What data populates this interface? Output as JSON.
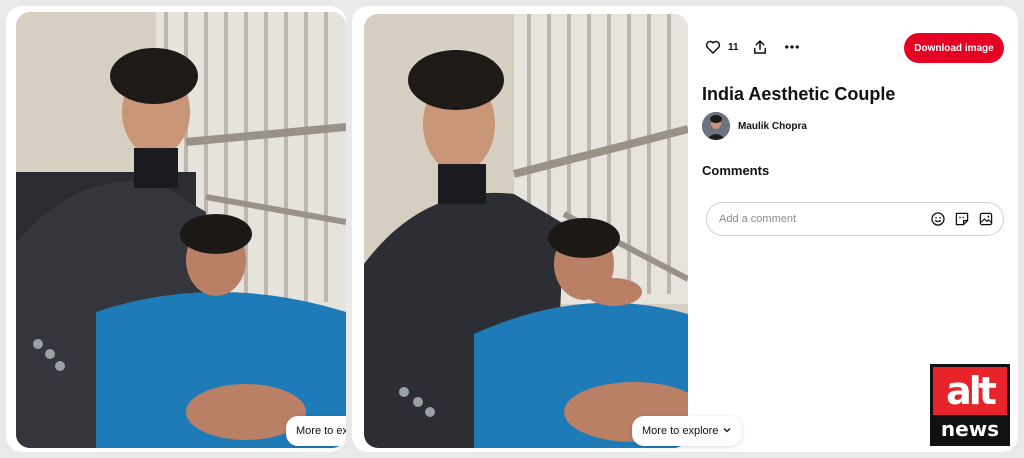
{
  "left_panel": {
    "explore_label": "More to explore"
  },
  "main_panel": {
    "explore_label": "More to explore"
  },
  "toolbar": {
    "like_icon": "heart-icon",
    "like_count": "11",
    "share_icon": "share-upload-icon",
    "more_icon": "ellipsis-icon",
    "download_label": "Download image"
  },
  "pin": {
    "title": "India Aesthetic Couple",
    "author": "Maulik Chopra"
  },
  "comments": {
    "heading": "Comments",
    "placeholder": "Add a comment",
    "icons": [
      "emoji-icon",
      "sticker-icon",
      "image-icon"
    ]
  },
  "watermark": {
    "top_text": "alt",
    "bottom_text": "news"
  },
  "colors": {
    "accent": "#e60023",
    "watermark_red": "#e8242b"
  }
}
